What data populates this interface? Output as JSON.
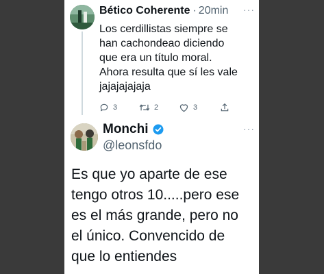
{
  "reply": {
    "author": "Bético Coherente",
    "separator": "·",
    "time": "20min",
    "more": "···",
    "lines": [
      "Los cerdillistas siempre se",
      "han cachondeao diciendo",
      "que era un título moral.",
      "Ahora resulta que sí les vale",
      "jajajajajaja"
    ],
    "actions": {
      "replies": "3",
      "retweets": "2",
      "likes": "3"
    }
  },
  "main": {
    "author": "Monchi",
    "handle": "@leonsfdo",
    "more": "···",
    "lines": [
      "Es que yo aparte de ese",
      "tengo otros 10.....pero ese",
      "es el más grande, pero no",
      "el único. Convencido de",
      "que lo entiendes"
    ]
  },
  "colors": {
    "verified": "#1d9bf0",
    "muted": "#536471",
    "text": "#0f1419"
  },
  "icons": {
    "reply": "reply-icon",
    "retweet": "retweet-icon",
    "like": "heart-icon",
    "share": "share-icon",
    "verified": "verified-badge-icon"
  }
}
